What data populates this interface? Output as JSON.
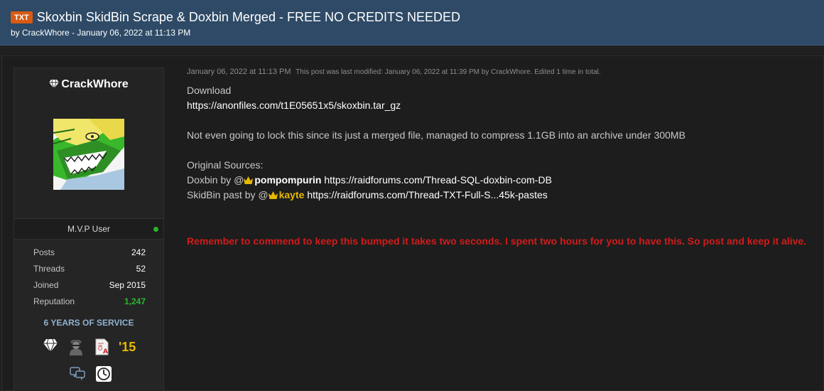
{
  "thread": {
    "prefix": "TXT",
    "title": "Skoxbin SkidBin Scrape & Doxbin Merged - FREE NO CREDITS NEEDED",
    "meta": "by CrackWhore - January 06, 2022 at 11:13 PM"
  },
  "author": {
    "username": "CrackWhore",
    "usergroup": "M.V.P User",
    "stats": [
      {
        "label": "Posts",
        "value": "242"
      },
      {
        "label": "Threads",
        "value": "52"
      },
      {
        "label": "Joined",
        "value": "Sep 2015"
      },
      {
        "label": "Reputation",
        "value": "1,247"
      }
    ],
    "service": "6 YEARS OF SERVICE",
    "year_award": "'15",
    "icons": [
      "diamond-icon",
      "agent-icon",
      "certificate-icon",
      "chat-icon",
      "clock-icon"
    ],
    "colors": {
      "online": "#2cb52c",
      "reputation": "#2fb82f",
      "service": "#8fb1d1"
    }
  },
  "post": {
    "date": "January 06, 2022 at 11:13 PM",
    "modified": "This post was last modified: January 06, 2022 at 11:39 PM by CrackWhore. Edited 1 time in total.",
    "line_download": "Download",
    "download_url": "https://anonfiles.com/t1E05651x5/skoxbin.tar_gz",
    "description": "Not even going to lock this since its just a merged file, managed to compress 1.1GB into an archive under 300MB",
    "sources_heading": "Original Sources:",
    "source1_prefix": "Doxbin by @",
    "source1_user": "pompompurin",
    "source1_url": "https://raidforums.com/Thread-SQL-doxbin-com-DB",
    "source2_prefix": "SkidBin past by @",
    "source2_user": "kayte",
    "source2_url": "https://raidforums.com/Thread-TXT-Full-S...45k-pastes",
    "note": "Remember to commend to keep this bumped it takes two seconds. I spent two hours for you to have this. So post and keep it alive.",
    "colors": {
      "note": "#d21b1b",
      "gold_user": "#e6b800"
    }
  }
}
